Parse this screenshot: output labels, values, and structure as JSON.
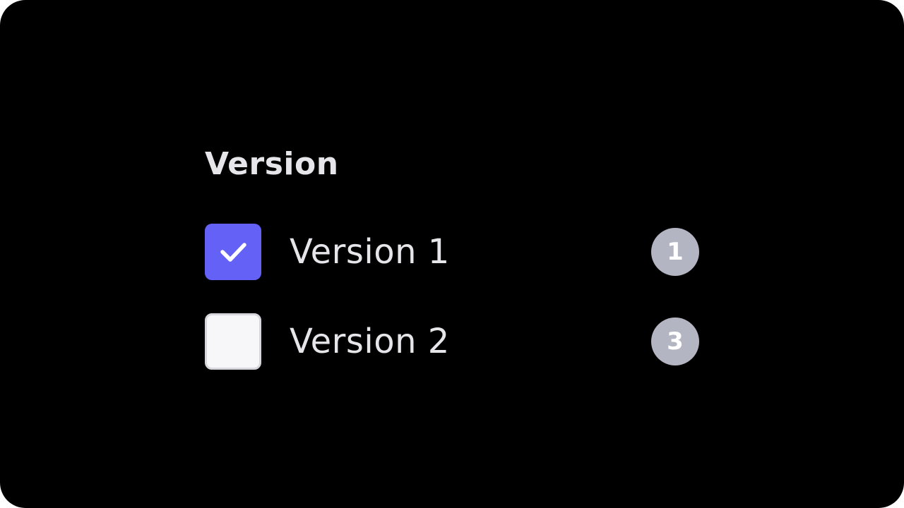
{
  "filter": {
    "title": "Version",
    "options": [
      {
        "label": "Version 1",
        "checked": true,
        "count": "1"
      },
      {
        "label": "Version 2",
        "checked": false,
        "count": "3"
      }
    ]
  },
  "colors": {
    "background": "#000000",
    "accent": "#6461f7",
    "text": "#e6e6ea",
    "badge": "#b3b5c3",
    "checkbox_unchecked": "#f7f7f9"
  },
  "icons": {
    "checked": "check-icon"
  }
}
